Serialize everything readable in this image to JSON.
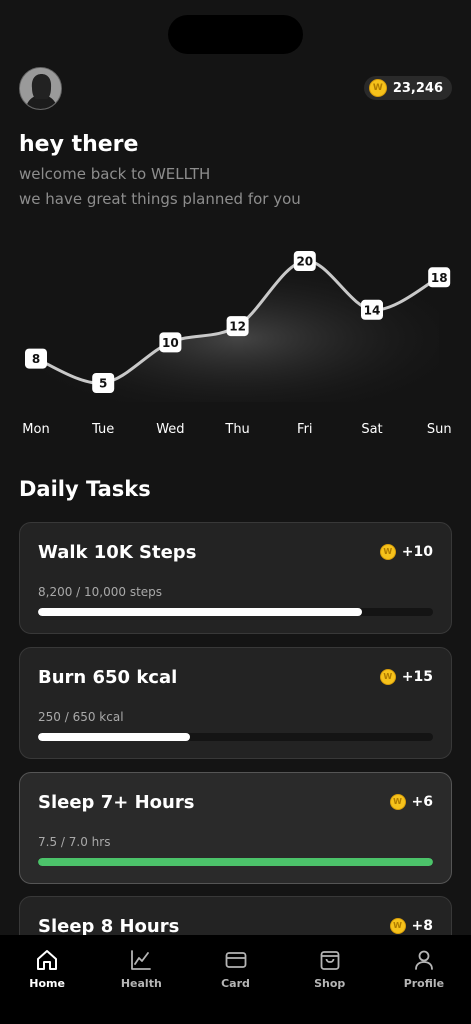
{
  "header": {
    "coin_symbol": "W",
    "coins": "23,246"
  },
  "greeting": {
    "title": "hey there",
    "line1": "welcome back to WELLTH",
    "line2": "we have great things planned for you"
  },
  "chart_data": {
    "type": "line",
    "categories": [
      "Mon",
      "Tue",
      "Wed",
      "Thu",
      "Fri",
      "Sat",
      "Sun"
    ],
    "values": [
      8,
      5,
      10,
      12,
      20,
      14,
      18
    ],
    "title": "",
    "xlabel": "",
    "ylabel": "",
    "grid": false
  },
  "tasks_title": "Daily Tasks",
  "tasks": [
    {
      "title": "Walk 10K Steps",
      "reward": "+10",
      "current": "8,200",
      "target": "10,000 steps",
      "progress": 0.82,
      "color": "#ffffff"
    },
    {
      "title": "Burn 650 kcal",
      "reward": "+15",
      "current": "250",
      "target": "650 kcal",
      "progress": 0.3846,
      "color": "#ffffff"
    },
    {
      "title": "Sleep 7+ Hours",
      "reward": "+6",
      "current": "7.5",
      "target": "7.0 hrs",
      "progress": 1.0,
      "color": "#4cc36a"
    },
    {
      "title": "Sleep 8 Hours",
      "reward": "+8"
    }
  ],
  "tabs": [
    {
      "label": "Home",
      "icon": "home-icon",
      "active": true
    },
    {
      "label": "Health",
      "icon": "health-chart-icon",
      "active": false
    },
    {
      "label": "Card",
      "icon": "card-icon",
      "active": false
    },
    {
      "label": "Shop",
      "icon": "shopping-bag-icon",
      "active": false
    },
    {
      "label": "Profile",
      "icon": "person-icon",
      "active": false
    }
  ]
}
